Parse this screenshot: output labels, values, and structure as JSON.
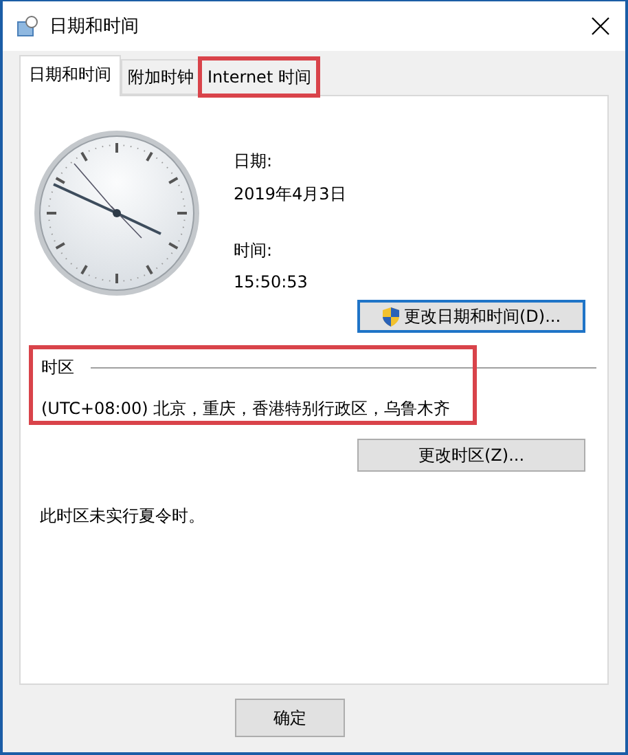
{
  "window": {
    "title": "日期和时间"
  },
  "tabs": [
    {
      "label": "日期和时间",
      "selected": true,
      "highlighted": false
    },
    {
      "label": "附加时钟",
      "selected": false,
      "highlighted": false
    },
    {
      "label": "Internet 时间",
      "selected": false,
      "highlighted": true
    }
  ],
  "date": {
    "label": "日期:",
    "value": "2019年4月3日"
  },
  "time": {
    "label": "时间:",
    "value": "15:50:53"
  },
  "change_datetime_button": {
    "label": "更改日期和时间(D)...",
    "shield": true
  },
  "time_zone": {
    "heading": "时区",
    "value": "(UTC+08:00) 北京，重庆，香港特别行政区，乌鲁木齐",
    "highlighted": true
  },
  "change_zone_button": {
    "label": "更改时区(Z)..."
  },
  "dst_note": "此时区未实行夏令时。",
  "buttons": [
    {
      "label": "确定"
    }
  ]
}
